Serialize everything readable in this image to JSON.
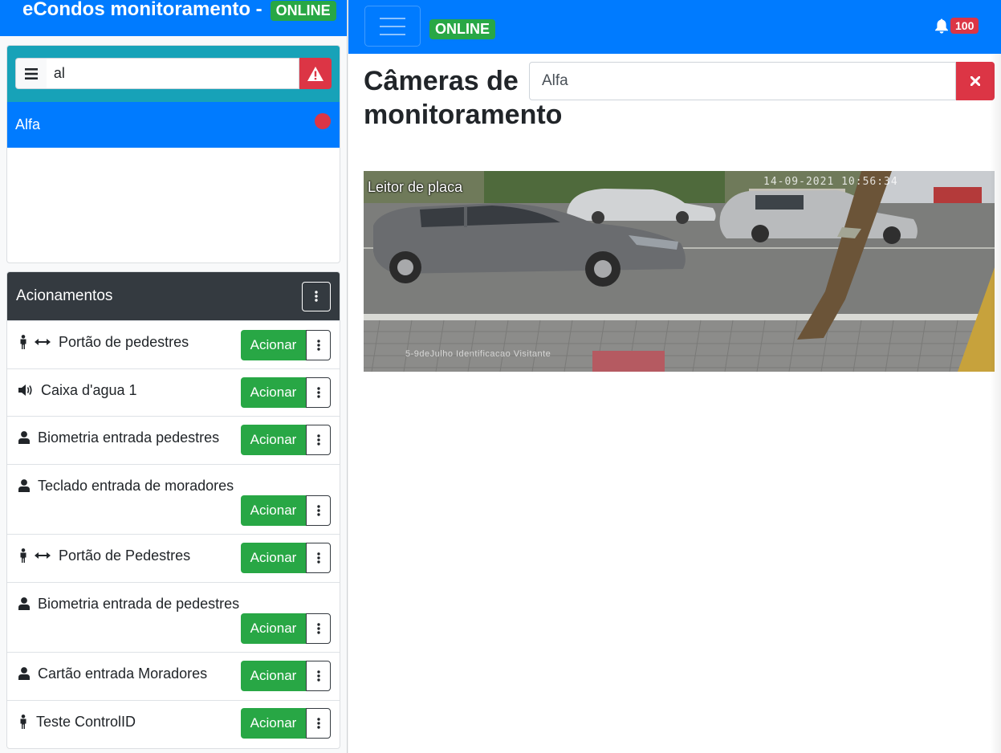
{
  "sidebar": {
    "title": "eCondos monitoramento  -",
    "status": "ONLINE",
    "search_value": "al",
    "list": [
      {
        "label": "Alfa",
        "status_color": "#dc3545"
      }
    ]
  },
  "actions": {
    "title": "Acionamentos",
    "button_label": "Acionar",
    "items": [
      {
        "label": "Portão de pedestres",
        "icon": "person-arrows-icon"
      },
      {
        "label": "Caixa d'agua 1",
        "icon": "volume-icon"
      },
      {
        "label": "Biometria entrada pedestres",
        "icon": "user-icon"
      },
      {
        "label": "Teclado entrada de moradores",
        "icon": "user-icon"
      },
      {
        "label": "Portão de Pedestres",
        "icon": "person-arrows-icon"
      },
      {
        "label": "Biometria entrada de pedestres",
        "icon": "user-icon"
      },
      {
        "label": "Cartão entrada Moradores",
        "icon": "user-icon"
      },
      {
        "label": "Teste ControlID",
        "icon": "person-icon"
      }
    ]
  },
  "topbar": {
    "status": "ONLINE",
    "notifications": "100"
  },
  "main": {
    "title": "Câmeras de monitoramento",
    "camera_search_value": "Alfa",
    "camera": {
      "name": "Leitor de placa",
      "timestamp": "14-09-2021 10:56:34",
      "caption": "5-9deJulho Identificacao Visitante"
    }
  },
  "colors": {
    "primary": "#007bff",
    "success": "#28a745",
    "danger": "#dc3545",
    "info": "#17a2b8",
    "dark": "#343a40"
  }
}
